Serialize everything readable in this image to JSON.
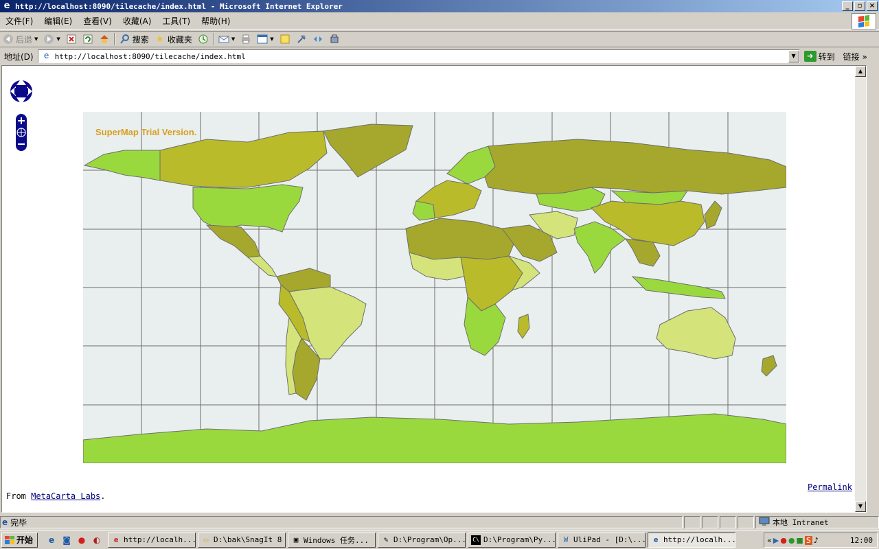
{
  "window": {
    "title": "http://localhost:8090/tilecache/index.html - Microsoft Internet Explorer",
    "buttons": [
      "_",
      "▫",
      "×"
    ]
  },
  "menubar": {
    "items": [
      "文件(F)",
      "编辑(E)",
      "查看(V)",
      "收藏(A)",
      "工具(T)",
      "帮助(H)"
    ]
  },
  "toolbar": {
    "back_label": "后退",
    "search_label": "搜索",
    "favorites_label": "收藏夹"
  },
  "addressbar": {
    "label": "地址(D)",
    "url": "http://localhost:8090/tilecache/index.html",
    "go_label": "转到",
    "links_label": "链接 »"
  },
  "page": {
    "map_watermark": "SuperMap Trial Version.",
    "from_prefix": "From ",
    "from_link": "MetaCarta Labs",
    "from_suffix": ".",
    "permalink": "Permalink"
  },
  "statusbar": {
    "status_text": "完毕",
    "zone_text": "本地 Intranet"
  },
  "taskbar": {
    "start_label": "开始",
    "tasks": [
      {
        "label": "http://localh...",
        "icon": "ie"
      },
      {
        "label": "D:\\bak\\SnagIt 8",
        "icon": "folder"
      },
      {
        "label": "Windows 任务...",
        "icon": "taskmgr"
      },
      {
        "label": "D:\\Program\\Op...",
        "icon": "notepad"
      },
      {
        "label": "D:\\Program\\Py...",
        "icon": "cmd"
      },
      {
        "label": "UliPad - [D:\\...",
        "icon": "ulipad"
      },
      {
        "label": "http://localh...",
        "icon": "ie"
      }
    ],
    "clock": "12:00"
  },
  "colors": {
    "map_ocean": "#e9efee",
    "land_olive": "#a5a82c",
    "land_lime": "#9ad93e",
    "land_pale": "#d4e47a",
    "land_yellow": "#b9bb2a",
    "watermark": "#d6a020"
  }
}
